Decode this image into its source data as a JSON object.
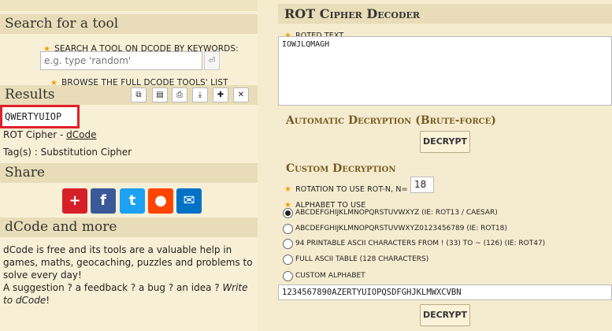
{
  "search": {
    "title": "Search for a tool",
    "label": "SEARCH A TOOL ON DCODE BY KEYWORDS:",
    "placeholder": "e.g. type 'random'",
    "browse_prefix": "BROWSE THE ",
    "browse_link": "FULL DCODE TOOLS' LIST"
  },
  "results": {
    "title": "Results",
    "value": "QWERTYUIOP",
    "tool_name": "ROT Cipher - ",
    "tool_link": "dCode",
    "tags": "Tag(s) : Substitution Cipher"
  },
  "share": {
    "title": "Share",
    "buttons": [
      "share-plus-icon",
      "facebook-icon",
      "twitter-icon",
      "reddit-icon",
      "email-icon"
    ]
  },
  "about": {
    "title": "dCode and more",
    "text": "dCode is free and its tools are a valuable help in games, maths, geocaching, puzzles and problems to solve every day!",
    "suggestion": "A suggestion ? a feedback ? a bug ? an idea ? ",
    "write_to": "Write to dCode",
    "exclaim": "!"
  },
  "decoder": {
    "title": "ROT Cipher Decoder",
    "roted_label": "ROTED TEXT",
    "roted_value": "IOWJLQMAGH",
    "auto_title": "Automatic Decryption (Brute-force)",
    "decrypt_label": "DECRYPT",
    "custom_title": "Custom Decryption",
    "rotation_label": "ROTATION TO USE ROT-N, N=",
    "rotation_value": "18",
    "alphabet_label": "ALPHABET TO USE",
    "options": [
      "ABCDEFGHIJKLMNOPQRSTUVWXYZ (IE: ROT13 / CAESAR)",
      "ABCDEFGHIJKLMNOPQRSTUVWXYZ0123456789 (IE: ROT18)",
      "94 PRINTABLE ASCII CHARACTERS FROM ! (33) TO ~ (126) (IE: ROT47)",
      "FULL ASCII TABLE (128 CHARACTERS)",
      "CUSTOM ALPHABET"
    ],
    "custom_alphabet_value": "1234567890AZERTYUIOPQSDFGHJKLMWXCVBN"
  },
  "colors": {
    "highlight": "#e0202a",
    "star": "#f0a000",
    "section_bg": "#e8ddb8"
  }
}
